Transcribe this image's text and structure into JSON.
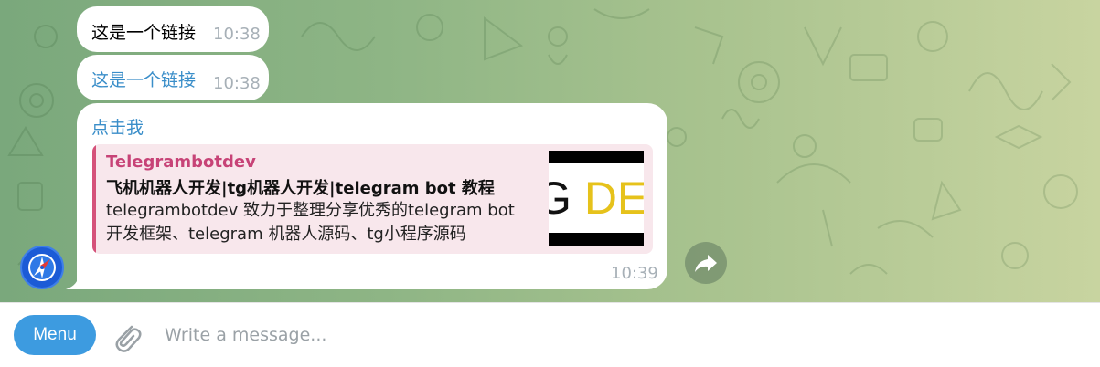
{
  "messages": [
    {
      "text": "这是一个链接",
      "time": "10:38",
      "is_link": false
    },
    {
      "text": "这是一个链接",
      "time": "10:38",
      "is_link": true
    }
  ],
  "link_message": {
    "text": "点击我",
    "time": "10:39",
    "preview": {
      "site_name": "Telegrambotdev",
      "title": "飞机机器人开发|tg机器人开发|telegram bot 教程",
      "description": "telegrambotdev 致力于整理分享优秀的telegram bot 开发框架、telegram 机器人源码、tg小程序源码",
      "thumbnail": {
        "text_left": "G",
        "text_right": "DEV"
      }
    }
  },
  "composer": {
    "menu_label": "Menu",
    "placeholder": "Write a message..."
  },
  "icons": {
    "avatar": "compass-avatar-icon",
    "share": "share-arrow-icon",
    "attach": "paperclip-icon"
  },
  "colors": {
    "accent": "#3d9be0",
    "link": "#3a8ec9",
    "preview_bar": "#d5527a",
    "preview_bg": "#f8e7ec",
    "time": "#a7b0b7"
  }
}
